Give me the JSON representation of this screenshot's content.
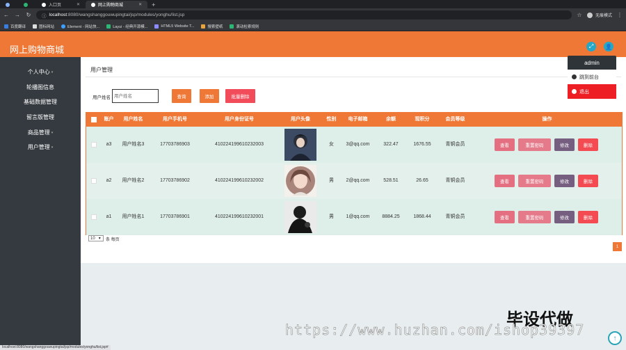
{
  "browser": {
    "tabs": [
      {
        "label": ""
      },
      {
        "label": ""
      },
      {
        "label": "入口页"
      },
      {
        "label": "网上购物商城"
      }
    ],
    "url_host": "localhost",
    "url_rest": ":8080/wangshanggouwupingtai/jsp/modules/yonghu/list.jsp",
    "profile_label": "无痕模式",
    "bookmarks": [
      "百度翻译",
      "图标网站",
      "Element - 网站快...",
      "Layui - 经典开源模...",
      "HTML5 Website T...",
      "搜索壁纸",
      "滚动检索规则"
    ]
  },
  "app": {
    "title": "网上购物商城",
    "dropdown": {
      "user": "admin",
      "front_label": "跳到前台",
      "logout_label": "退出"
    }
  },
  "sidebar": {
    "items": [
      {
        "label": "个人中心",
        "chevron": true
      },
      {
        "label": "轮播图信息",
        "chevron": false
      },
      {
        "label": "基础数据管理",
        "chevron": false
      },
      {
        "label": "留言版管理",
        "chevron": false
      },
      {
        "label": "商品管理",
        "chevron": true
      },
      {
        "label": "用户管理",
        "chevron": true
      }
    ]
  },
  "page": {
    "title": "用户管理",
    "search_label": "用户姓名",
    "search_placeholder": "用户姓名",
    "search_button": "查询",
    "add_button": "添加",
    "batch_delete_button": "批量删除"
  },
  "table": {
    "headers": [
      "账户",
      "用户姓名",
      "用户手机号",
      "用户身份证号",
      "用户头像",
      "性别",
      "电子邮箱",
      "余额",
      "现积分",
      "会员等级",
      "操作"
    ],
    "rows": [
      {
        "account": "a3",
        "name": "用户姓名3",
        "phone": "17703786903",
        "id_card": "410224199610232003",
        "gender": "女",
        "email": "3@qq.com",
        "balance": "322.47",
        "points": "1676.55",
        "level": "青铜会员"
      },
      {
        "account": "a2",
        "name": "用户姓名2",
        "phone": "17703786902",
        "id_card": "410224199610232002",
        "gender": "男",
        "email": "2@qq.com",
        "balance": "528.51",
        "points": "26.65",
        "level": "青铜会员"
      },
      {
        "account": "a1",
        "name": "用户姓名1",
        "phone": "17703786901",
        "id_card": "410224199610232001",
        "gender": "男",
        "email": "1@qq.com",
        "balance": "8884.25",
        "points": "1868.44",
        "level": "青铜会员"
      }
    ],
    "actions": {
      "view": "查看",
      "reset": "重置密码",
      "edit": "修改",
      "delete": "删除"
    }
  },
  "pager": {
    "page_size": "10",
    "page_size_label": "条 每页",
    "current_page": "1"
  },
  "overlay": {
    "watermark": "https://www.huzhan.com/ishop39397",
    "watermark_cn": "毕设代做",
    "status_url": "localhost:8080/wangshanggouwupingtai/jsp/modules/yonghu/list.jsp#"
  },
  "colors": {
    "accent": "#f07837",
    "sidebar": "#343a3f",
    "logout": "#ee1e25"
  }
}
